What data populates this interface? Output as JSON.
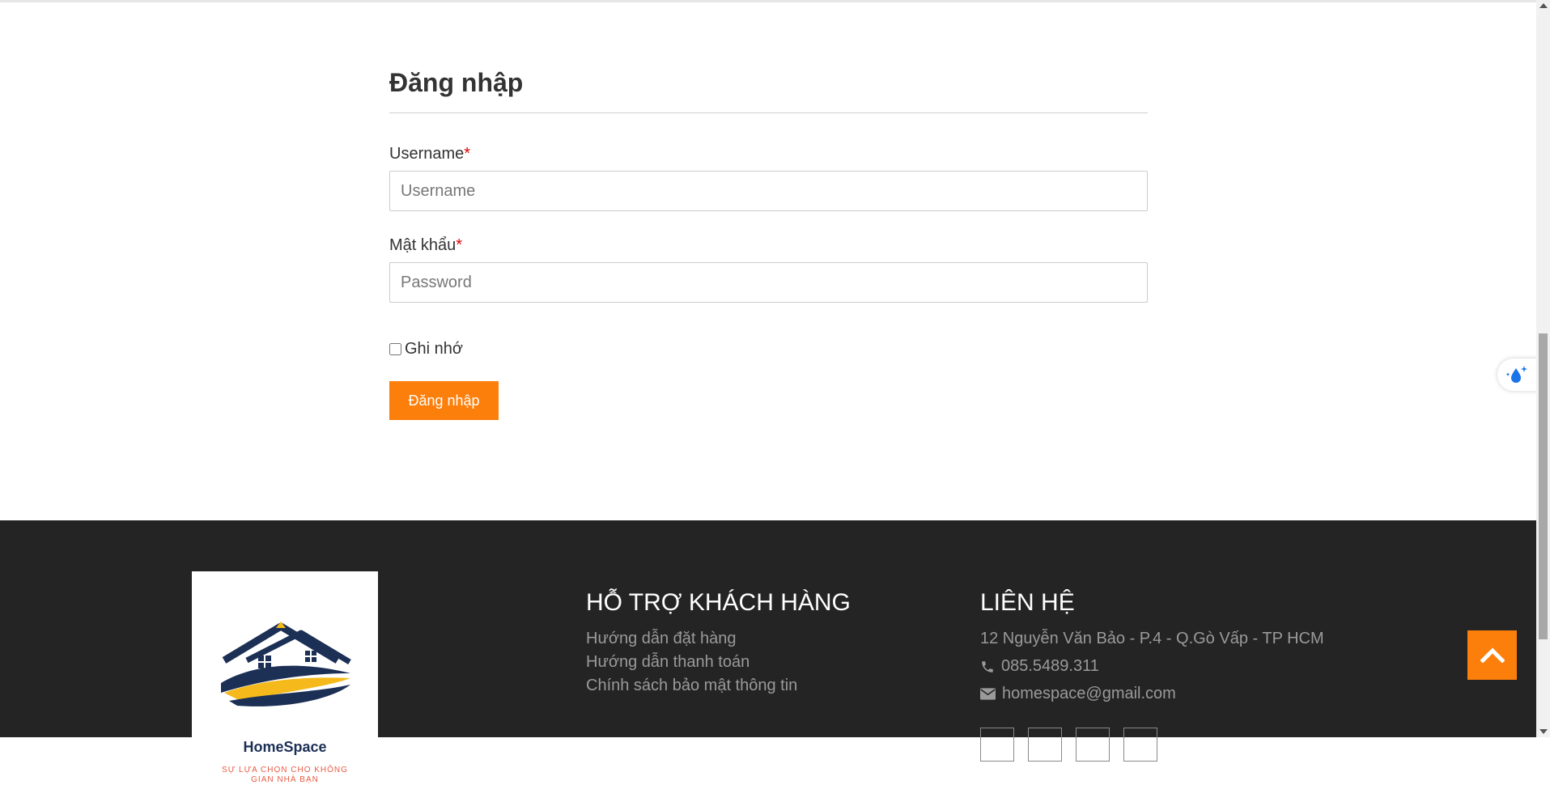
{
  "login": {
    "title": "Đăng nhập",
    "username_label": "Username",
    "username_placeholder": "Username",
    "password_label": "Mật khẩu",
    "password_placeholder": "Password",
    "required_mark": "*",
    "remember_label": "Ghi nhớ",
    "submit_label": "Đăng nhập"
  },
  "footer": {
    "logo": {
      "name": "HomeSpace",
      "tagline": "SỰ LỰA CHỌN CHO KHÔNG GIAN NHÀ BẠN"
    },
    "support": {
      "title": "HỖ TRỢ KHÁCH HÀNG",
      "links": [
        "Hướng dẫn đặt hàng",
        "Hướng dẫn thanh toán",
        "Chính sách bảo mật thông tin"
      ]
    },
    "contact": {
      "title": "LIÊN HỆ",
      "address": "12 Nguyễn Văn Bảo - P.4 - Q.Gò Vấp - TP HCM",
      "phone": "085.5489.311",
      "email": "homespace@gmail.com"
    },
    "social_icons": [
      "facebook-icon",
      "youtube-icon",
      "instagram-icon",
      "tiktok-icon"
    ]
  },
  "colors": {
    "accent": "#fc7f0b",
    "footer_bg": "#242424",
    "required": "#e10000",
    "logo_navy": "#1c2f55",
    "logo_yellow": "#f5b91b"
  }
}
